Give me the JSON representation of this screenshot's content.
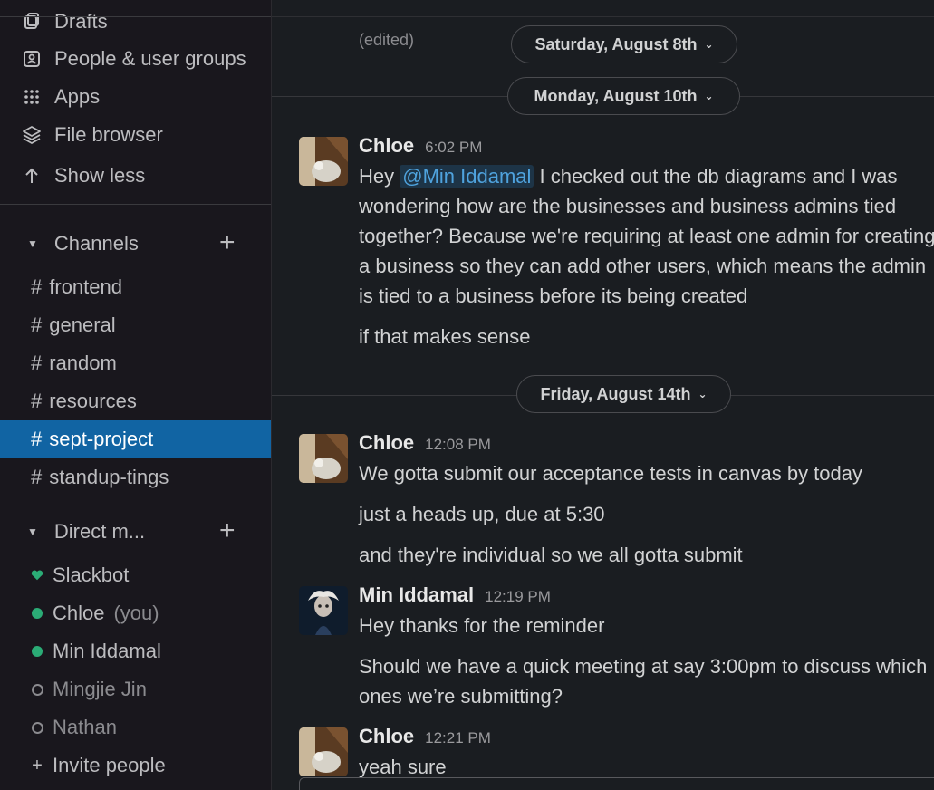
{
  "sidebar": {
    "nav": [
      {
        "label": "Drafts",
        "icon": "drafts-icon"
      },
      {
        "label": "People & user groups",
        "icon": "people-icon"
      },
      {
        "label": "Apps",
        "icon": "apps-grid-icon"
      },
      {
        "label": "File browser",
        "icon": "layers-icon"
      },
      {
        "label": "Show less",
        "icon": "arrow-up-icon"
      }
    ],
    "channels_header": "Channels",
    "channels": [
      "frontend",
      "general",
      "random",
      "resources",
      "sept-project",
      "standup-tings"
    ],
    "active_channel": "sept-project",
    "dm_header": "Direct m...",
    "dms": [
      {
        "name": "Slackbot",
        "status": "bot"
      },
      {
        "name": "Chloe",
        "suffix": "(you)",
        "status": "online"
      },
      {
        "name": "Min Iddamal",
        "status": "online"
      },
      {
        "name": "Mingjie Jin",
        "status": "away"
      },
      {
        "name": "Nathan",
        "status": "away"
      }
    ],
    "invite_label": "Invite people",
    "colors": {
      "active_bg": "#1164a3",
      "online": "#2bac76",
      "slackbot_heart": "#2bac76"
    }
  },
  "main": {
    "edited_label": "(edited)",
    "days": [
      "Saturday, August 8th",
      "Monday, August 10th",
      "Friday, August 14th"
    ],
    "messages": [
      {
        "author": "Chloe",
        "time": "6:02 PM",
        "mention": "@Min Iddamal",
        "text_after_mention": " I checked out the db diagrams and I was wondering how are the businesses and business admins tied together? Because we're requiring at least one admin for creating a business so they can add other users, which means the admin is tied to a business before its being created",
        "text_prefix": "Hey ",
        "followups": [
          "if that makes sense"
        ]
      },
      {
        "author": "Chloe",
        "time": "12:08 PM",
        "text": "We gotta submit our acceptance tests in canvas by today",
        "followups": [
          "just a heads up, due at 5:30",
          "and they're individual so we all gotta submit"
        ]
      },
      {
        "author": "Min Iddamal",
        "time": "12:19 PM",
        "text": "Hey thanks for the reminder",
        "followups": [
          "Should we have a quick meeting at say 3:00pm to discuss which ones we’re submitting?"
        ]
      },
      {
        "author": "Chloe",
        "time": "12:21 PM",
        "text": "yeah sure"
      }
    ]
  }
}
